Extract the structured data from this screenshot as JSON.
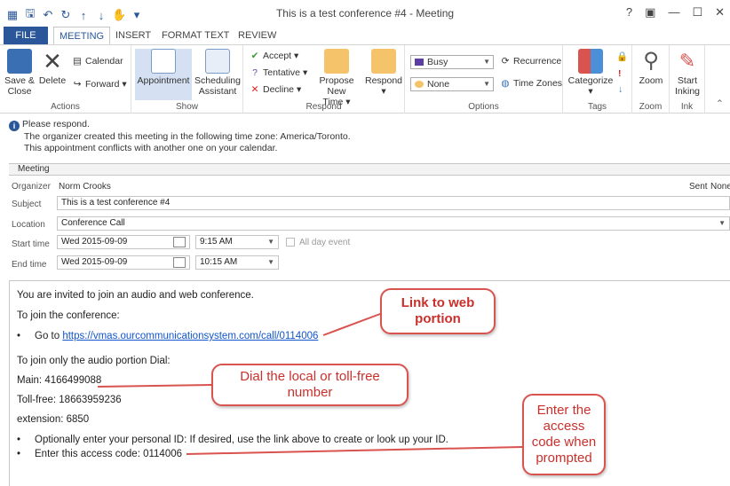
{
  "window": {
    "title": "This is a test conference #4 - Meeting",
    "controls": [
      "?",
      "▣",
      "—",
      "☐",
      "✕"
    ]
  },
  "tabs": [
    {
      "label": "FILE"
    },
    {
      "label": "MEETING"
    },
    {
      "label": "INSERT"
    },
    {
      "label": "FORMAT TEXT"
    },
    {
      "label": "REVIEW"
    }
  ],
  "ribbon": {
    "actions": {
      "label": "Actions",
      "save_close": [
        "Save &",
        "Close"
      ],
      "delete": "Delete",
      "calendar": "Calendar",
      "forward": "Forward"
    },
    "show": {
      "label": "Show",
      "appointment": "Appointment",
      "scheduling": [
        "Scheduling",
        "Assistant"
      ]
    },
    "respond": {
      "label": "Respond",
      "accept": "Accept",
      "tentative": "Tentative",
      "decline": "Decline",
      "propose": [
        "Propose New",
        "Time"
      ],
      "respond": "Respond"
    },
    "options": {
      "label": "Options",
      "show_as": "Busy",
      "reminder": "None",
      "recurrence": "Recurrence",
      "time_zones": "Time Zones"
    },
    "tags": {
      "label": "Tags",
      "categorize": "Categorize"
    },
    "zoom": {
      "label": "Zoom",
      "zoom": "Zoom"
    },
    "ink": {
      "label": "Ink",
      "start_inking": [
        "Start",
        "Inking"
      ]
    }
  },
  "info": {
    "line1": "Please respond.",
    "line2": "The organizer created this meeting in the following time zone: America/Toronto.",
    "line3": "This appointment conflicts with another one on your calendar."
  },
  "form": {
    "tab": "Meeting",
    "organizer_label": "Organizer",
    "organizer": "Norm Crooks",
    "sent_label": "Sent",
    "sent_value": "None",
    "subject_label": "Subject",
    "subject": "This is a test conference #4",
    "location_label": "Location",
    "location": "Conference Call",
    "start_label": "Start time",
    "start_date": "Wed 2015-09-09",
    "start_time": "9:15 AM",
    "all_day": "All day event",
    "end_label": "End time",
    "end_date": "Wed 2015-09-09",
    "end_time": "10:15 AM"
  },
  "body": {
    "line1": "You are invited to join an audio and web conference.",
    "line2": "To join the conference:",
    "goto": "Go to ",
    "link": "https://vmas.ourcommunicationsystem.com/call/0114006",
    "line4": "To join only the audio portion Dial:",
    "main": "Main: 4166499088",
    "tollfree": "Toll-free: 18663959236",
    "extension": "extension: 6850",
    "bullet1": "Optionally enter your personal ID: If desired, use the link above to create or look up your ID.",
    "bullet2": "Enter this access code: 0114006"
  },
  "callouts": {
    "web": [
      "Link to web",
      "portion"
    ],
    "dial": [
      "Dial the local or toll-free",
      "number"
    ],
    "access": [
      "Enter the",
      "access",
      "code when",
      "prompted"
    ]
  },
  "colors": {
    "accent": "#2b579a",
    "callout": "#d9534f",
    "link": "#1155cc"
  }
}
